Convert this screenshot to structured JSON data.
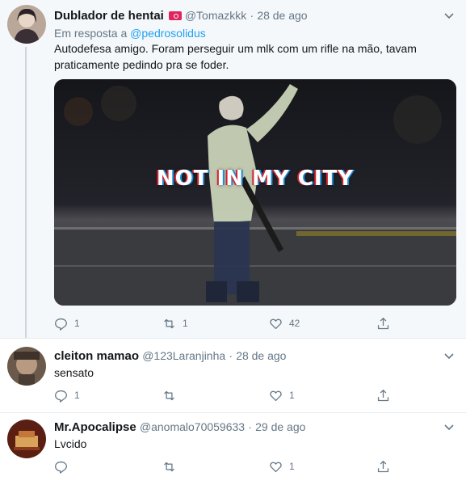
{
  "tweets": [
    {
      "display_name": "Dublador de hentai",
      "handle": "@Tomazkkk",
      "separator": "·",
      "date": "28 de ago",
      "reply_prefix": "Em resposta a",
      "reply_handle": "@pedrosolidus",
      "text_line1": "Autodefesa amigo. Foram perseguir um mlk com um rifle na mão, tavam",
      "text_line2": "praticamente pedindo pra se foder.",
      "media_caption": "NOT IN MY CITY",
      "replies": "1",
      "retweets": "1",
      "likes": "42"
    },
    {
      "display_name": "cleiton mamao",
      "handle": "@123Laranjinha",
      "separator": "·",
      "date": "28 de ago",
      "text": "sensato",
      "replies": "1",
      "retweets": "",
      "likes": "1"
    },
    {
      "display_name": "Mr.Apocalipse",
      "handle": "@anomalo70059633",
      "separator": "·",
      "date": "29 de ago",
      "text": "Lvcido",
      "replies": "",
      "retweets": "",
      "likes": "1"
    }
  ],
  "colors": {
    "link": "#1da1f2",
    "muted": "#657786",
    "highlight_bg": "#f5f8fa",
    "flag": "#e0245e"
  },
  "icons": [
    "reply-icon",
    "retweet-icon",
    "like-icon",
    "share-icon",
    "chevron-down-icon"
  ]
}
